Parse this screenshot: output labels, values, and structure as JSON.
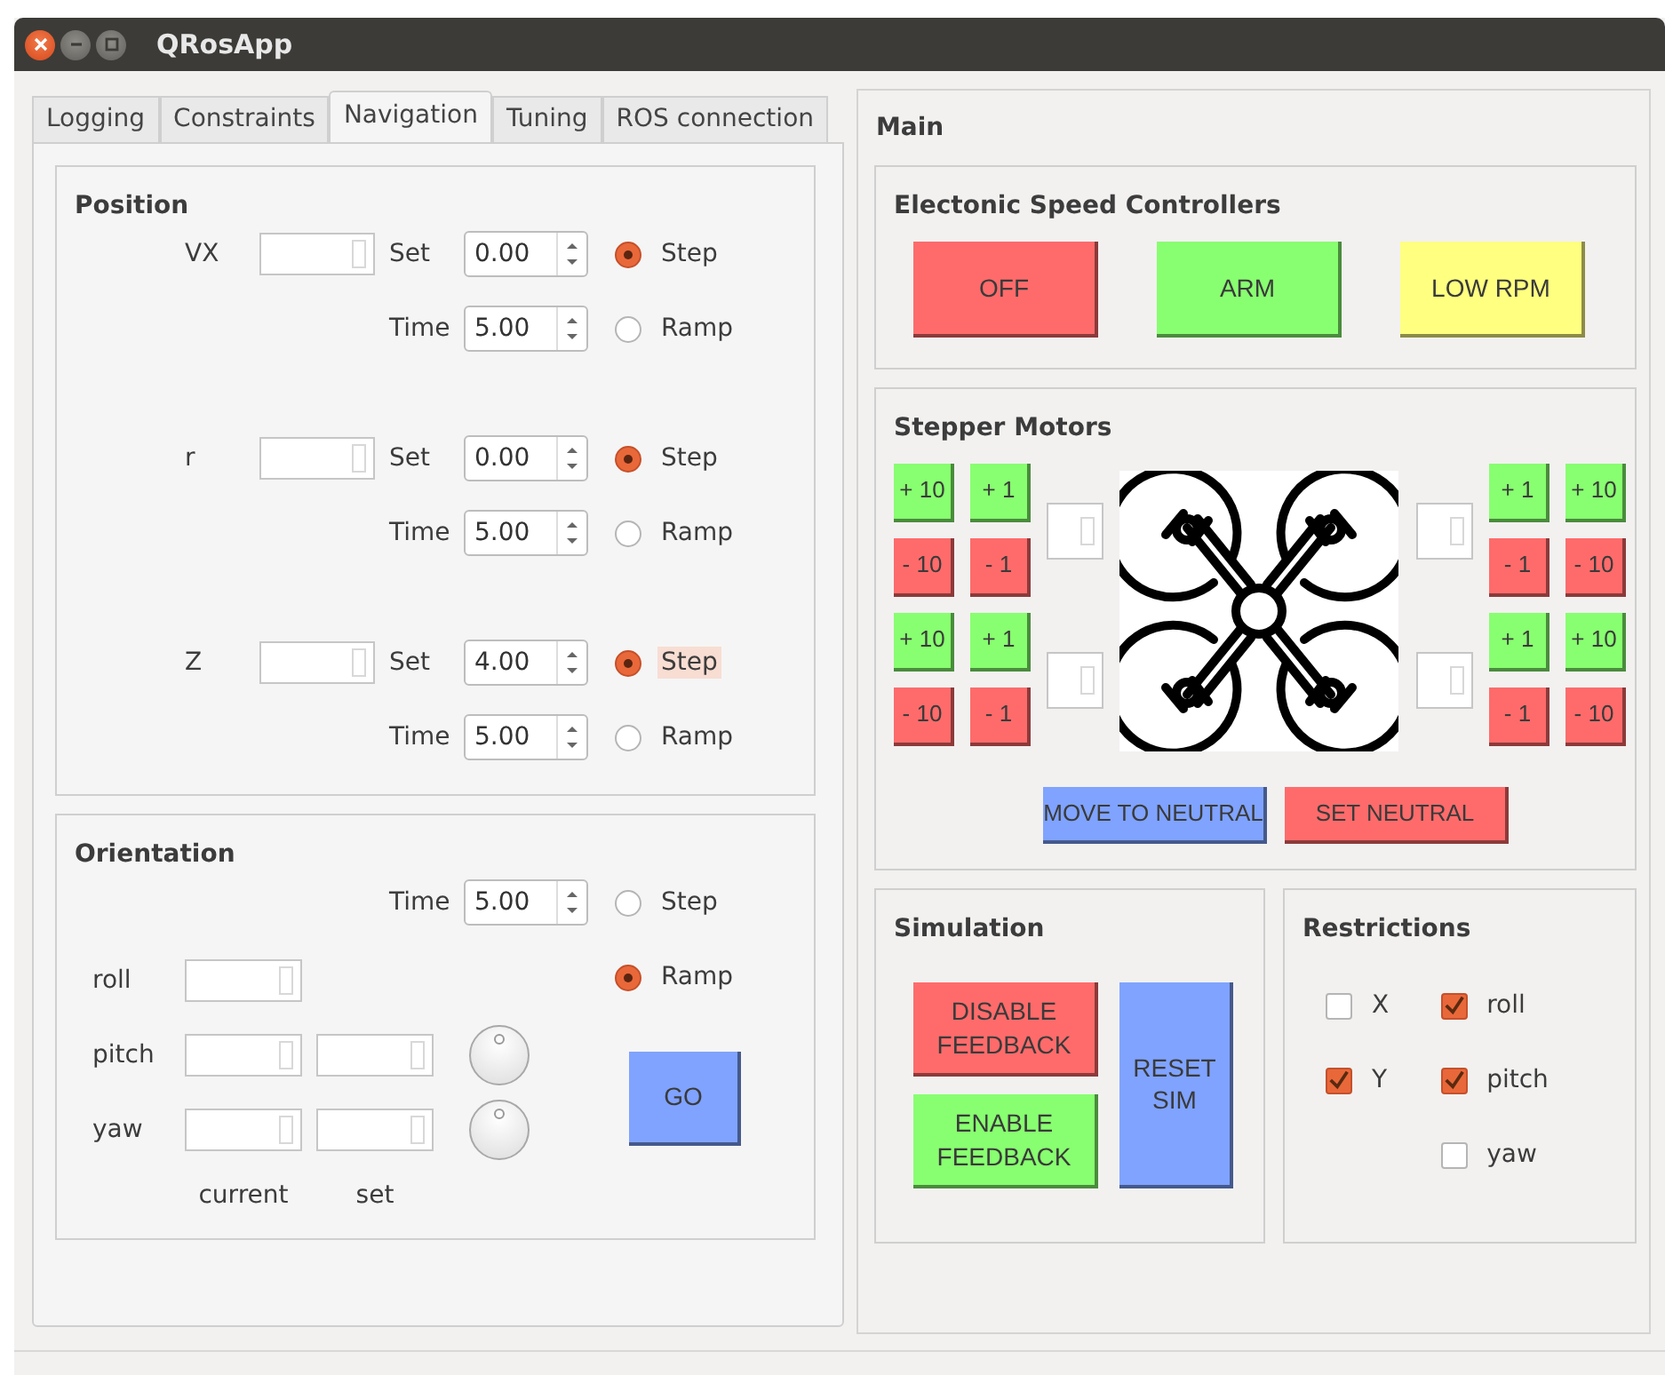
{
  "window": {
    "title": "QRosApp"
  },
  "tabs": [
    {
      "label": "Logging",
      "selected": false
    },
    {
      "label": "Constraints",
      "selected": false
    },
    {
      "label": "Navigation",
      "selected": true
    },
    {
      "label": "Tuning",
      "selected": false
    },
    {
      "label": "ROS connection",
      "selected": false
    }
  ],
  "position": {
    "title": "Position",
    "rows": [
      {
        "label": "VX",
        "set_label": "Set",
        "set_value": "0.00",
        "time_label": "Time",
        "time_value": "5.00",
        "options": [
          {
            "label": "Step",
            "selected": true,
            "focused": false
          },
          {
            "label": "Ramp",
            "selected": false,
            "focused": false
          }
        ]
      },
      {
        "label": "r",
        "set_label": "Set",
        "set_value": "0.00",
        "time_label": "Time",
        "time_value": "5.00",
        "options": [
          {
            "label": "Step",
            "selected": true,
            "focused": false
          },
          {
            "label": "Ramp",
            "selected": false,
            "focused": false
          }
        ]
      },
      {
        "label": "Z",
        "set_label": "Set",
        "set_value": "4.00",
        "time_label": "Time",
        "time_value": "5.00",
        "options": [
          {
            "label": "Step",
            "selected": true,
            "focused": true
          },
          {
            "label": "Ramp",
            "selected": false,
            "focused": false
          }
        ]
      }
    ]
  },
  "orientation": {
    "title": "Orientation",
    "time_label": "Time",
    "time_value": "5.00",
    "options": [
      {
        "label": "Step",
        "selected": false
      },
      {
        "label": "Ramp",
        "selected": true
      }
    ],
    "rows": [
      {
        "label": "roll",
        "set_field": false,
        "dial": false
      },
      {
        "label": "pitch",
        "set_field": true,
        "dial": true
      },
      {
        "label": "yaw",
        "set_field": true,
        "dial": true
      }
    ],
    "column_labels": [
      "current",
      "set"
    ],
    "go_button": "GO"
  },
  "main": {
    "title": "Main"
  },
  "esc": {
    "title": "Electonic Speed Controllers",
    "buttons": [
      {
        "label": "OFF",
        "color": "#ff6b6b"
      },
      {
        "label": "ARM",
        "color": "#88ff70"
      },
      {
        "label": "LOW RPM",
        "color": "#ffff80"
      }
    ]
  },
  "stepper": {
    "title": "Stepper Motors",
    "left": [
      [
        {
          "label": "+ 10",
          "kind": "increase"
        },
        {
          "label": "+ 1",
          "kind": "increase"
        }
      ],
      [
        {
          "label": "- 10",
          "kind": "decrease"
        },
        {
          "label": "- 1",
          "kind": "decrease"
        }
      ],
      [
        {
          "label": "+ 10",
          "kind": "increase"
        },
        {
          "label": "+ 1",
          "kind": "increase"
        }
      ],
      [
        {
          "label": "- 10",
          "kind": "decrease"
        },
        {
          "label": "- 1",
          "kind": "decrease"
        }
      ]
    ],
    "right": [
      [
        {
          "label": "+ 1",
          "kind": "increase"
        },
        {
          "label": "+ 10",
          "kind": "increase"
        }
      ],
      [
        {
          "label": "- 1",
          "kind": "decrease"
        },
        {
          "label": "- 10",
          "kind": "decrease"
        }
      ],
      [
        {
          "label": "+ 1",
          "kind": "increase"
        },
        {
          "label": "+ 10",
          "kind": "increase"
        }
      ],
      [
        {
          "label": "- 1",
          "kind": "decrease"
        },
        {
          "label": "- 10",
          "kind": "decrease"
        }
      ]
    ],
    "buttons": [
      {
        "label": "MOVE TO NEUTRAL",
        "color": "#7fa3ff"
      },
      {
        "label": "SET NEUTRAL",
        "color": "#ff6b6b"
      }
    ]
  },
  "simulation": {
    "title": "Simulation",
    "buttons": [
      {
        "label": "DISABLE FEEDBACK",
        "color": "#ff6b6b"
      },
      {
        "label": "ENABLE FEEDBACK",
        "color": "#88ff70"
      }
    ],
    "reset_button": {
      "label": "RESET SIM",
      "color": "#7fa3ff"
    }
  },
  "restrictions": {
    "title": "Restrictions",
    "columns": [
      [
        {
          "label": "X",
          "checked": false
        },
        {
          "label": "Y",
          "checked": true
        }
      ],
      [
        {
          "label": "roll",
          "checked": true
        },
        {
          "label": "pitch",
          "checked": true
        },
        {
          "label": "yaw",
          "checked": false
        }
      ]
    ]
  }
}
